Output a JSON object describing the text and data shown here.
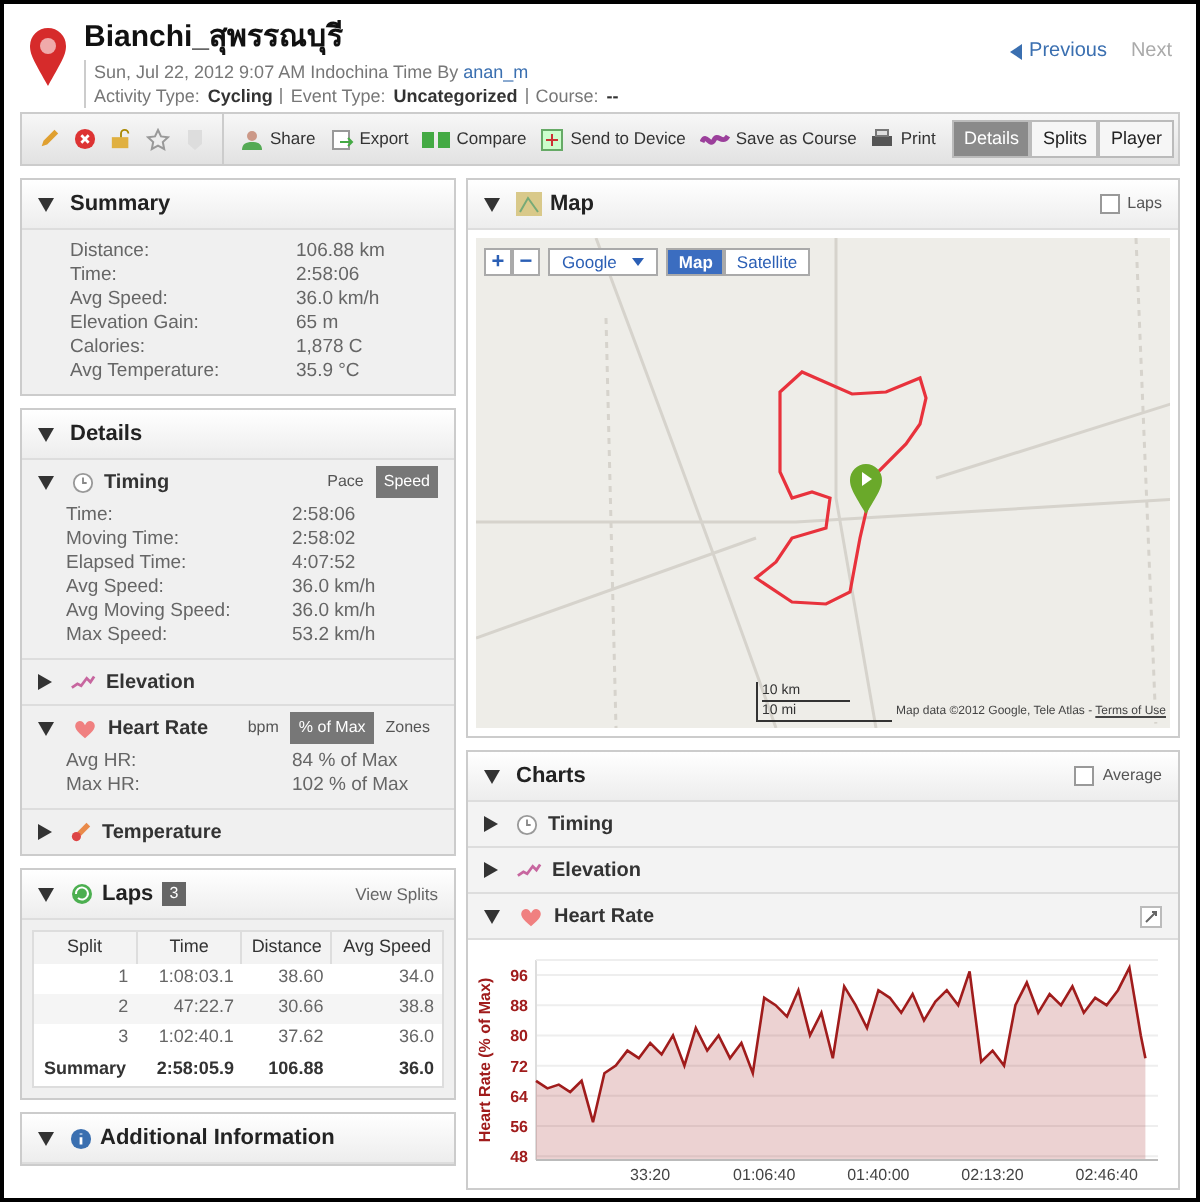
{
  "header": {
    "title": "Bianchi_สุพรรณบุรี",
    "date": "Sun, Jul 22, 2012 9:07 AM Indochina Time By",
    "author": "anan_m",
    "meta": [
      {
        "label": "Activity Type:",
        "value": "Cycling"
      },
      {
        "label": "Event Type:",
        "value": "Uncategorized"
      },
      {
        "label": "Course:",
        "value": "--"
      }
    ],
    "nav": [
      {
        "label": "Previous",
        "disabled": false
      },
      {
        "label": "Next",
        "disabled": true
      }
    ]
  },
  "toolbar": {
    "actions": [
      "Share",
      "Export",
      "Compare",
      "Send to Device",
      "Save as Course",
      "Print"
    ],
    "views": [
      {
        "label": "Details",
        "selected": true
      },
      {
        "label": "Splits",
        "selected": false
      },
      {
        "label": "Player",
        "selected": false
      }
    ]
  },
  "summary": {
    "title": "Summary",
    "expanded": true,
    "rows": [
      {
        "label": "Distance:",
        "value": "106.88 km"
      },
      {
        "label": "Time:",
        "value": "2:58:06"
      },
      {
        "label": "Avg Speed:",
        "value": "36.0 km/h"
      },
      {
        "label": "Elevation Gain:",
        "value": "65 m"
      },
      {
        "label": "Calories:",
        "value": "1,878 C"
      },
      {
        "label": "Avg Temperature:",
        "value": "35.9 °C"
      }
    ]
  },
  "details": {
    "title": "Details",
    "expanded": true,
    "sections": [
      {
        "kind": "timing",
        "title": "Timing",
        "expanded": true,
        "toggles": [
          {
            "label": "Pace",
            "selected": false
          },
          {
            "label": "Speed",
            "selected": true
          }
        ],
        "rows": [
          {
            "label": "Time:",
            "value": "2:58:06"
          },
          {
            "label": "Moving Time:",
            "value": "2:58:02"
          },
          {
            "label": "Elapsed Time:",
            "value": "4:07:52"
          },
          {
            "label": "Avg Speed:",
            "value": "36.0 km/h"
          },
          {
            "label": "Avg Moving Speed:",
            "value": "36.0 km/h"
          },
          {
            "label": "Max Speed:",
            "value": "53.2 km/h"
          }
        ]
      },
      {
        "kind": "elevation",
        "title": "Elevation",
        "expanded": false
      },
      {
        "kind": "heart",
        "title": "Heart Rate",
        "expanded": true,
        "toggles": [
          {
            "label": "bpm",
            "selected": false
          },
          {
            "label": "% of Max",
            "selected": true
          },
          {
            "label": "Zones",
            "selected": false
          }
        ],
        "rows": [
          {
            "label": "Avg HR:",
            "value": "84 % of Max"
          },
          {
            "label": "Max HR:",
            "value": "102 % of Max"
          }
        ]
      },
      {
        "kind": "temperature",
        "title": "Temperature",
        "expanded": false
      }
    ]
  },
  "laps": {
    "title": "Laps",
    "count": "3",
    "expanded": true,
    "link": "View Splits",
    "columns": [
      "Split",
      "Time",
      "Distance",
      "Avg Speed"
    ],
    "rows": [
      [
        "1",
        "1:08:03.1",
        "38.60",
        "34.0"
      ],
      [
        "2",
        "47:22.7",
        "30.66",
        "38.8"
      ],
      [
        "3",
        "1:02:40.1",
        "37.62",
        "36.0"
      ]
    ],
    "summary": [
      "Summary",
      "2:58:05.9",
      "106.88",
      "36.0"
    ]
  },
  "additional": {
    "title": "Additional Information",
    "expanded": true
  },
  "map": {
    "title": "Map",
    "expanded": true,
    "laps_checkbox": {
      "label": "Laps",
      "checked": false
    },
    "zoom_in": "+",
    "zoom_out": "−",
    "provider": "Google",
    "modes": [
      {
        "label": "Map",
        "selected": true
      },
      {
        "label": "Satellite",
        "selected": false
      }
    ],
    "scale": [
      "10 km",
      "10 mi"
    ],
    "attribution": "Map data ©2012 Google, Tele Atlas - ",
    "terms": "Terms of Use"
  },
  "charts": {
    "title": "Charts",
    "expanded": true,
    "average_checkbox": {
      "label": "Average",
      "checked": false
    },
    "sections": [
      {
        "kind": "timing",
        "title": "Timing",
        "expanded": false
      },
      {
        "kind": "elevation",
        "title": "Elevation",
        "expanded": false
      },
      {
        "kind": "heart",
        "title": "Heart Rate",
        "expanded": true
      }
    ],
    "chart_data": {
      "type": "area",
      "ylabel": "Heart Rate (% of Max)",
      "x": [
        0,
        200,
        400,
        600,
        800,
        1000,
        1200,
        1400,
        1600,
        1800,
        2000,
        2200,
        2400,
        2600,
        2800,
        3000,
        3200,
        3400,
        3600,
        3800,
        4000,
        4200,
        4400,
        4600,
        4800,
        5000,
        5200,
        5400,
        5600,
        5800,
        6000,
        6200,
        6400,
        6600,
        6800,
        7000,
        7200,
        7400,
        7600,
        7800,
        8000,
        8200,
        8400,
        8600,
        8800,
        9000,
        9200,
        9400,
        9600,
        9800,
        10000,
        10200,
        10400,
        10600,
        10680
      ],
      "grid": true,
      "series": [
        {
          "color": "#a01c1c",
          "values": [
            68,
            66,
            67,
            65,
            68,
            57,
            70,
            72,
            76,
            74,
            78,
            75,
            80,
            72,
            82,
            76,
            80,
            74,
            78,
            70,
            90,
            88,
            85,
            92,
            80,
            86,
            74,
            93,
            88,
            82,
            92,
            90,
            86,
            91,
            84,
            89,
            92,
            88,
            97,
            73,
            76,
            72,
            88,
            94,
            86,
            91,
            88,
            93,
            86,
            90,
            88,
            92,
            98,
            80,
            74
          ]
        }
      ],
      "xlim": [
        0,
        10900
      ],
      "ylim": [
        47,
        100
      ],
      "yticks": [
        48,
        56,
        64,
        72,
        80,
        88,
        96
      ],
      "xticks": [
        {
          "value": 2000,
          "label": "33:20"
        },
        {
          "value": 4000,
          "label": "01:06:40"
        },
        {
          "value": 6000,
          "label": "01:40:00"
        },
        {
          "value": 8000,
          "label": "02:13:20"
        },
        {
          "value": 10000,
          "label": "02:46:40"
        }
      ]
    }
  }
}
